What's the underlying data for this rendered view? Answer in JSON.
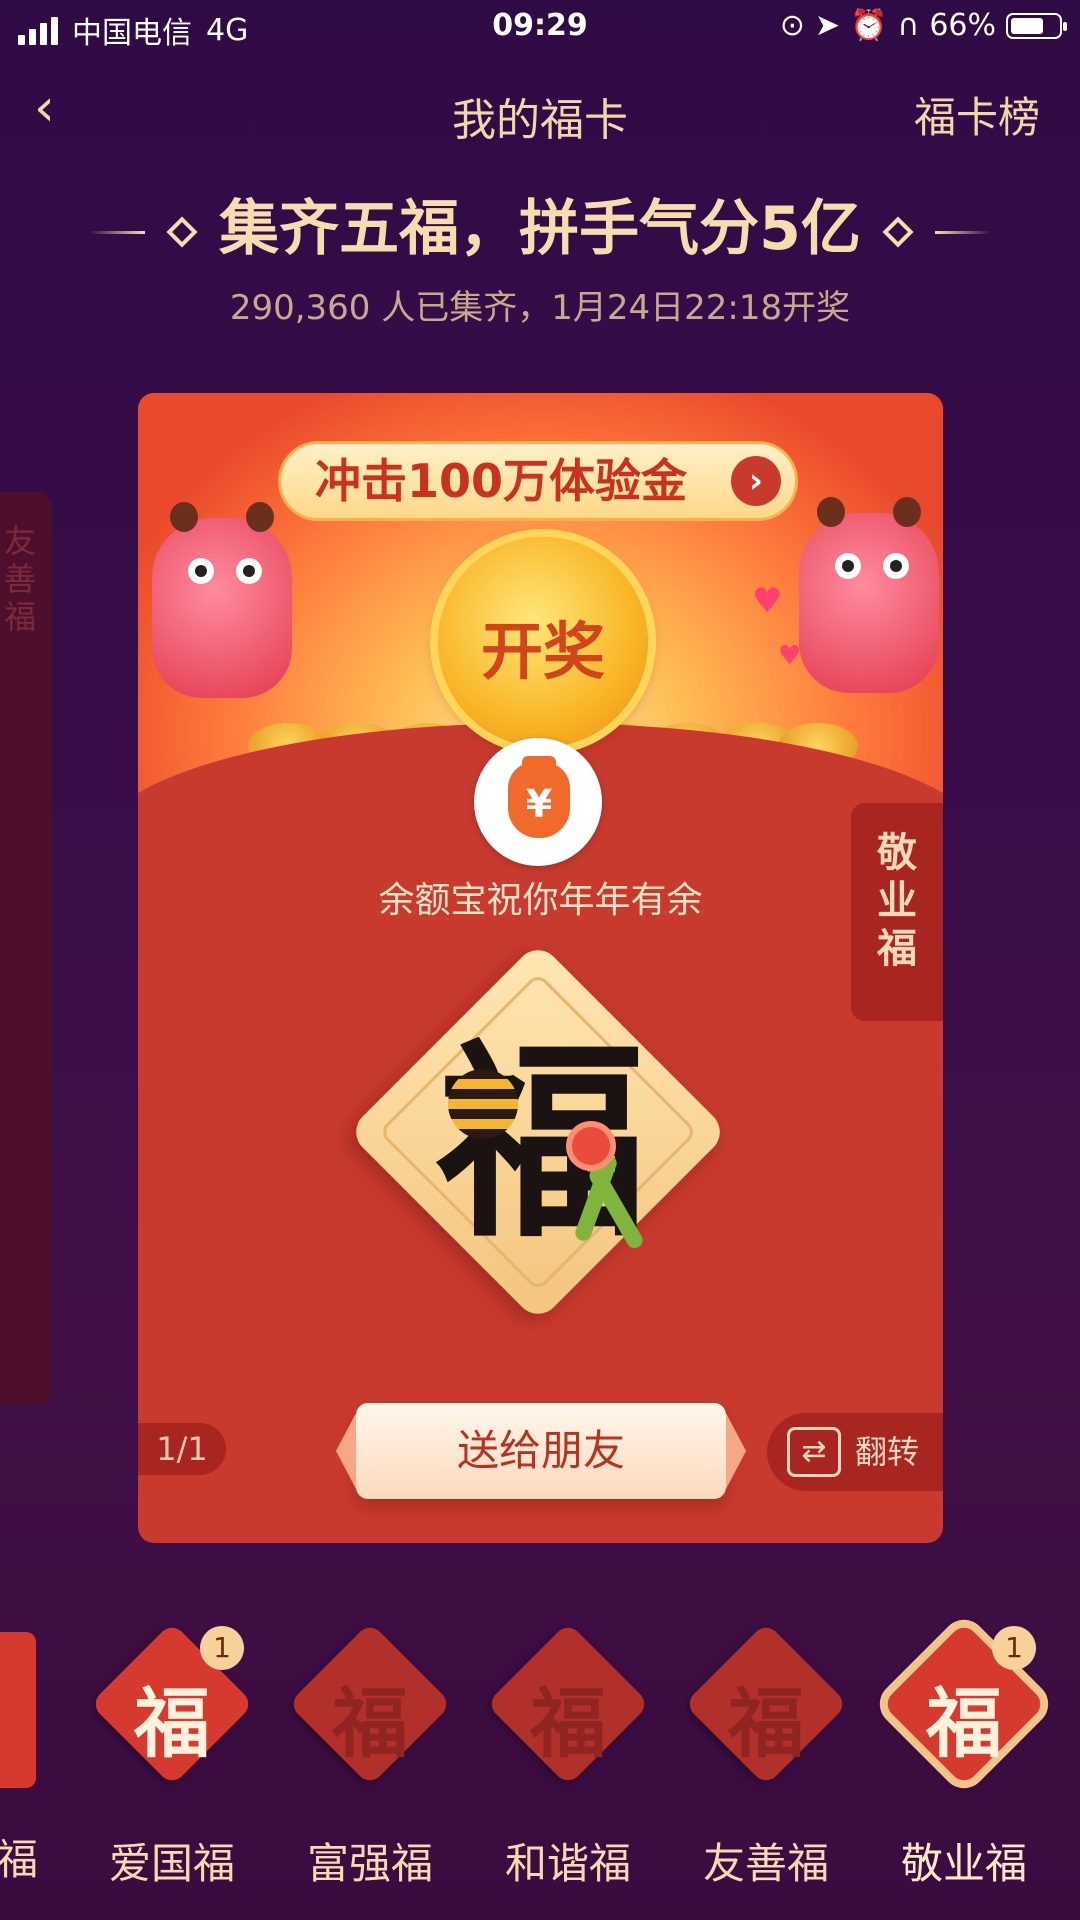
{
  "status_bar": {
    "carrier": "中国电信",
    "network": "4G",
    "time": "09:29",
    "battery": "66%"
  },
  "nav": {
    "back_icon": "chevron-left-icon",
    "title": "我的福卡",
    "right_link": "福卡榜"
  },
  "headline": {
    "title": "集齐五福，拼手气分5亿",
    "subtitle": "290,360 人已集齐，1月24日22:18开奖"
  },
  "left_peek_card": {
    "label": "友善福"
  },
  "main_card": {
    "banner_pill": "冲击100万体验金",
    "coin_label": "开奖",
    "sponsor_wish": "余额宝祝你年年有余",
    "side_tag": "敬业福",
    "fu_glyph": "福",
    "pager": "1/1",
    "send_button": "送给朋友",
    "flip_button": "翻转"
  },
  "bottom_cards": [
    {
      "name": "爱国福",
      "glyph": "福",
      "count": "1",
      "owned": true
    },
    {
      "name": "富强福",
      "glyph": "福",
      "count": "",
      "owned": false
    },
    {
      "name": "和谐福",
      "glyph": "福",
      "count": "",
      "owned": false
    },
    {
      "name": "友善福",
      "glyph": "福",
      "count": "",
      "owned": false
    },
    {
      "name": "敬业福",
      "glyph": "福",
      "count": "1",
      "owned": true,
      "selected": true
    }
  ],
  "left_edge_name": "福",
  "colors": {
    "background": "#3a0d4a",
    "card_red": "#c93a2e",
    "gold_text": "#f3d6a8"
  }
}
